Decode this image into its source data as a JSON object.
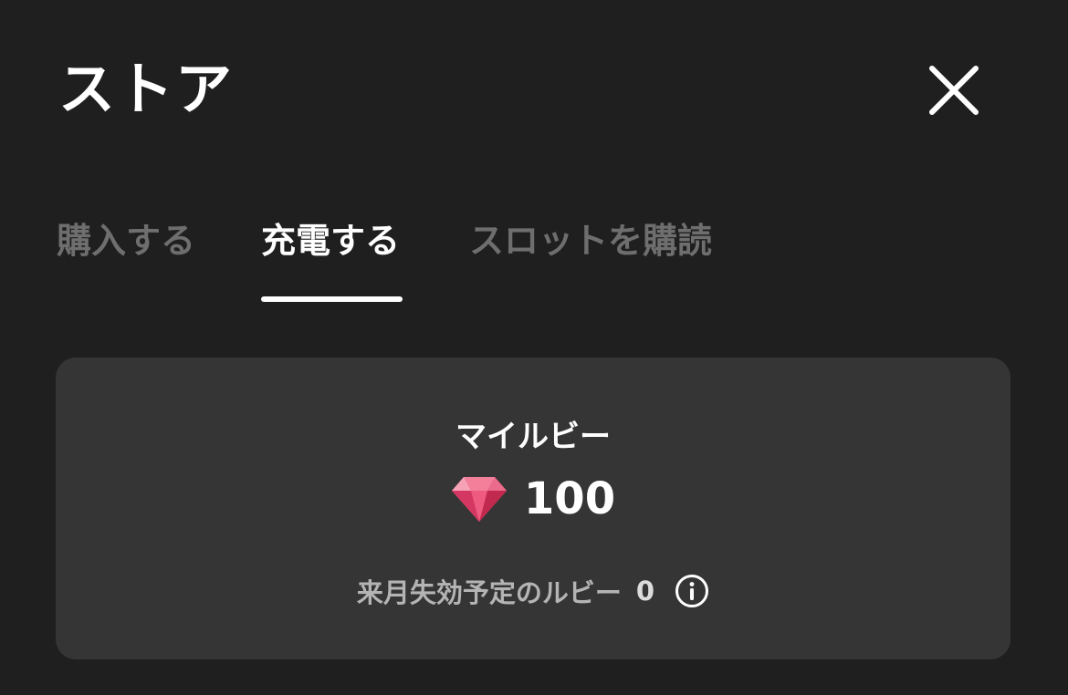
{
  "header": {
    "title": "ストア",
    "close_icon": "close-icon"
  },
  "tabs": [
    {
      "label": "購入する",
      "active": false
    },
    {
      "label": "充電する",
      "active": true
    },
    {
      "label": "スロットを購読",
      "active": false
    }
  ],
  "balance": {
    "label": "マイルビー",
    "icon": "ruby-icon",
    "value": "100",
    "expiring_label": "来月失効予定のルビー",
    "expiring_value": "0",
    "info_icon": "info-icon"
  },
  "colors": {
    "background": "#1f1f1f",
    "card": "#353535",
    "text_primary": "#ffffff",
    "text_inactive": "#6e6e6e",
    "ruby": "#e8486f"
  }
}
